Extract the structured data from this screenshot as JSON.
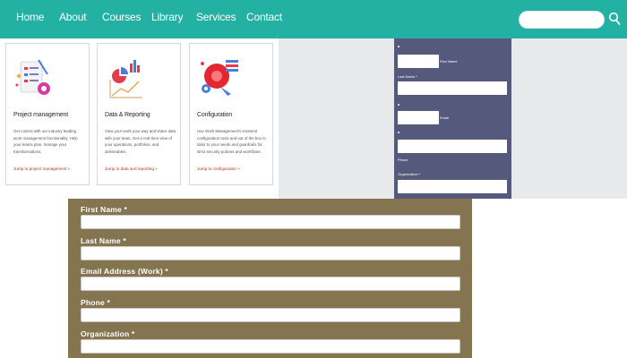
{
  "nav": {
    "items": [
      "Home",
      "About",
      "Courses",
      "Library",
      "Services",
      "Contact"
    ],
    "search_placeholder": ""
  },
  "cards": [
    {
      "title": "Project management",
      "desc": "Get control with our industry leading work management functionality. Help your teams plan, manage your transformations.",
      "link": "Jump to project management »"
    },
    {
      "title": "Data & Reporting",
      "desc": "View your work your way and share data with your team. Get a real-time view of your operations, portfolios, and deliverables.",
      "link": "Jump to data and reporting »"
    },
    {
      "title": "Configuration",
      "desc": "Use Work Management's smartest configuration tools and out of the box to tailor to your needs and guardrails for strict security policies and workflows.",
      "link": "Jump to configuration »"
    }
  ],
  "small_form": {
    "first_name_label": "First Name",
    "last_name_label": "Last Name *",
    "email_label": "Email",
    "phone_label": "Phone",
    "organization_label": "Organization *"
  },
  "big_form": {
    "fields": [
      {
        "label": "First Name *",
        "value": ""
      },
      {
        "label": "Last Name *",
        "value": ""
      },
      {
        "label": "Email Address (Work) *",
        "value": ""
      },
      {
        "label": "Phone *",
        "value": ""
      },
      {
        "label": "Organization *",
        "value": ""
      }
    ]
  },
  "colors": {
    "nav_bg": "#22b1a3",
    "small_form_bg": "#55597c",
    "big_form_bg": "#84744f",
    "link": "#b0341f"
  }
}
